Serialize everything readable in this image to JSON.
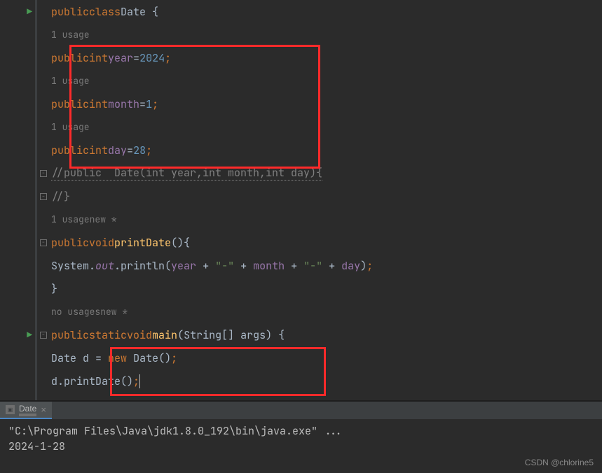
{
  "code": {
    "line1": {
      "kw1": "public",
      "kw2": "class",
      "name": "Date",
      "brace": " {"
    },
    "hint_usage": "1 usage",
    "hint_nousages": "no usages",
    "hint_new": "new *",
    "field1": {
      "mod": "public",
      "type": "int",
      "name": "year",
      "eq": "=",
      "val": "2024",
      "semi": ";"
    },
    "field2": {
      "mod": "public",
      "type": "int",
      "name": "month",
      "eq": "=",
      "val": "1",
      "semi": ";"
    },
    "field3": {
      "mod": "public",
      "type": "int",
      "name": "day",
      "eq": "=",
      "val": "28",
      "semi": ";"
    },
    "comment1": "//public  Date(int year,int month,int day){",
    "comment2": "//}",
    "printDate": {
      "mod": "public",
      "ret": "void",
      "name": "printDate",
      "paren": "(){"
    },
    "println": {
      "pre": "System.",
      "out": "out",
      "dot": ".println(",
      "a1": "year",
      "p1": " + ",
      "s1": "\"-\"",
      "p2": " + ",
      "a2": "month",
      "p3": " + ",
      "s2": "\"-\"",
      "p4": " + ",
      "a3": "day",
      "end": ");"
    },
    "closeBrace": "}",
    "mainSig": {
      "mod": "public",
      "static": "static",
      "ret": "void",
      "name": "main",
      "args": "(String[] args) {"
    },
    "newDate": {
      "type1": "Date",
      "var": " d = ",
      "kw": "new",
      "sp": " ",
      "ctor": "Date()",
      "semi": ";"
    },
    "callPrint": {
      "obj": "d.printDate()",
      "semi": ";"
    }
  },
  "console": {
    "tab_name": "Date",
    "line1": "\"C:\\Program Files\\Java\\jdk1.8.0_192\\bin\\java.exe\" ...",
    "line2": "2024-1-28"
  },
  "watermark": "CSDN @chlorine5"
}
